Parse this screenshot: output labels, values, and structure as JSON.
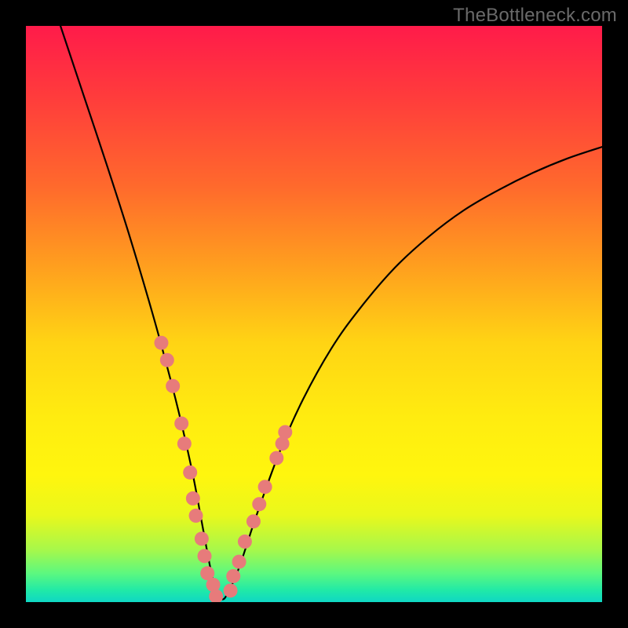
{
  "watermark": "TheBottleneck.com",
  "chart_data": {
    "type": "line",
    "title": "",
    "xlabel": "",
    "ylabel": "",
    "xlim": [
      0,
      100
    ],
    "ylim": [
      0,
      100
    ],
    "grid": false,
    "legend": false,
    "series": [
      {
        "name": "bottleneck-curve",
        "stroke": "#000000",
        "stroke_width": 2.2,
        "x": [
          6,
          10,
          14,
          18,
          22,
          25,
          27,
          29,
          30.5,
          32,
          33,
          34,
          35,
          37,
          40,
          44,
          48,
          53,
          58,
          64,
          70,
          76,
          82,
          88,
          94,
          100
        ],
        "y": [
          100,
          88,
          76,
          63.5,
          50,
          39,
          31,
          22,
          14,
          6,
          2,
          0.5,
          1.5,
          6,
          15,
          26,
          35,
          44,
          51,
          58,
          63.5,
          68,
          71.5,
          74.5,
          77,
          79
        ]
      },
      {
        "name": "dots-left",
        "type": "scatter",
        "fill": "#e77b7b",
        "radius": 9,
        "x": [
          23.5,
          24.5,
          25.5,
          27.0,
          27.5,
          28.5,
          29.0,
          29.5,
          30.5,
          31.0,
          31.5,
          32.5,
          33.0
        ],
        "y": [
          45.0,
          42.0,
          37.5,
          31.0,
          27.5,
          22.5,
          18.0,
          15.0,
          11.0,
          8.0,
          5.0,
          3.0,
          1.0
        ]
      },
      {
        "name": "dots-right",
        "type": "scatter",
        "fill": "#e77b7b",
        "radius": 9,
        "x": [
          35.5,
          36.0,
          37.0,
          38.0,
          39.5,
          40.5,
          41.5,
          43.5,
          44.5,
          45.0
        ],
        "y": [
          2.0,
          4.5,
          7.0,
          10.5,
          14.0,
          17.0,
          20.0,
          25.0,
          27.5,
          29.5
        ]
      }
    ]
  }
}
